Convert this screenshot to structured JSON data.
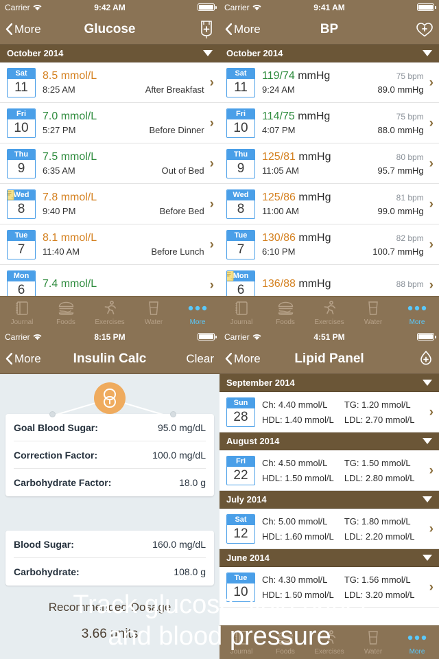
{
  "caption": {
    "line1": "Track glucose, lipid panel",
    "line2": "and blood pressure"
  },
  "colors": {
    "nav_bar": "#8a7355",
    "month_header": "#6b5637",
    "badge_blue": "#4a9fe8",
    "value_normal": "#2e8b3d",
    "value_high": "#d4801f",
    "tab_active": "#5ac8fa",
    "pill_circle": "#efab5e"
  },
  "tabbar": {
    "items": [
      {
        "label": "Journal",
        "icon": "journal-icon",
        "active": false
      },
      {
        "label": "Foods",
        "icon": "burger-icon",
        "active": false
      },
      {
        "label": "Exercises",
        "icon": "runner-icon",
        "active": false
      },
      {
        "label": "Water",
        "icon": "glass-icon",
        "active": false
      },
      {
        "label": "More",
        "icon": "ellipsis-icon",
        "active": true
      }
    ]
  },
  "glucose": {
    "status": {
      "carrier": "Carrier",
      "time": "9:42 AM",
      "wifi": "wifi-icon",
      "battery": "battery-icon"
    },
    "nav": {
      "back": "More",
      "title": "Glucose",
      "action_icon": "iv-bag-plus-icon"
    },
    "month": "October 2014",
    "rows": [
      {
        "dow": "Sat",
        "day": "11",
        "value": "8.5",
        "unit": "mmol/L",
        "level": "high",
        "time": "8:25 AM",
        "tag": "After Breakfast",
        "note": false
      },
      {
        "dow": "Fri",
        "day": "10",
        "value": "7.0",
        "unit": "mmol/L",
        "level": "normal",
        "time": "5:27 PM",
        "tag": "Before Dinner",
        "note": false
      },
      {
        "dow": "Thu",
        "day": "9",
        "value": "7.5",
        "unit": "mmol/L",
        "level": "normal",
        "time": "6:35 AM",
        "tag": "Out of Bed",
        "note": false
      },
      {
        "dow": "Wed",
        "day": "8",
        "value": "7.8",
        "unit": "mmol/L",
        "level": "high",
        "time": "9:40 PM",
        "tag": "Before Bed",
        "note": true
      },
      {
        "dow": "Tue",
        "day": "7",
        "value": "8.1",
        "unit": "mmol/L",
        "level": "high",
        "time": "11:40 AM",
        "tag": "Before Lunch",
        "note": false
      },
      {
        "dow": "Mon",
        "day": "6",
        "value": "7.4",
        "unit": "mmol/L",
        "level": "normal",
        "time": "",
        "tag": "",
        "note": false
      }
    ]
  },
  "bp": {
    "status": {
      "carrier": "Carrier",
      "time": "9:41 AM",
      "wifi": "wifi-icon",
      "battery": "battery-icon"
    },
    "nav": {
      "back": "More",
      "title": "BP",
      "action_icon": "heart-plus-icon"
    },
    "month": "October 2014",
    "rows": [
      {
        "dow": "Sat",
        "day": "11",
        "value": "119/74",
        "unit": "mmHg",
        "level": "normal",
        "time": "9:24 AM",
        "bpm": "75 bpm",
        "map": "89.0 mmHg",
        "note": false
      },
      {
        "dow": "Fri",
        "day": "10",
        "value": "114/75",
        "unit": "mmHg",
        "level": "normal",
        "time": "4:07 PM",
        "bpm": "75 bpm",
        "map": "88.0 mmHg",
        "note": false
      },
      {
        "dow": "Thu",
        "day": "9",
        "value": "125/81",
        "unit": "mmHg",
        "level": "high",
        "time": "11:05 AM",
        "bpm": "80 bpm",
        "map": "95.7 mmHg",
        "note": false
      },
      {
        "dow": "Wed",
        "day": "8",
        "value": "125/86",
        "unit": "mmHg",
        "level": "high",
        "time": "11:00 AM",
        "bpm": "81 bpm",
        "map": "99.0 mmHg",
        "note": false
      },
      {
        "dow": "Tue",
        "day": "7",
        "value": "130/86",
        "unit": "mmHg",
        "level": "high",
        "time": "6:10 PM",
        "bpm": "82 bpm",
        "map": "100.7 mmHg",
        "note": false
      },
      {
        "dow": "Mon",
        "day": "6",
        "value": "136/88",
        "unit": "mmHg",
        "level": "high",
        "time": "",
        "bpm": "88 bpm",
        "map": "",
        "note": true
      }
    ]
  },
  "insulin": {
    "status": {
      "carrier": "Carrier",
      "time": "8:15 PM",
      "wifi": "wifi-icon",
      "battery": "battery-icon"
    },
    "nav": {
      "back": "More",
      "title": "Insulin Calc",
      "action": "Clear"
    },
    "icon": "pill-icon",
    "card_one": [
      {
        "label": "Goal Blood Sugar:",
        "value": "95.0 mg/dL"
      },
      {
        "label": "Correction Factor:",
        "value": "100.0 mg/dL"
      },
      {
        "label": "Carbohydrate Factor:",
        "value": "18.0 g"
      }
    ],
    "card_two": [
      {
        "label": "Blood Sugar:",
        "value": "160.0 mg/dL"
      },
      {
        "label": "Carbohydrate:",
        "value": "108.0 g"
      }
    ],
    "dosage_label": "Recommended Dosage",
    "dosage_value": "3.66 units"
  },
  "lipid": {
    "status": {
      "carrier": "Carrier",
      "time": "4:51 PM",
      "wifi": "wifi-icon",
      "battery": "battery-icon"
    },
    "nav": {
      "back": "More",
      "title": "Lipid Panel",
      "action_icon": "blood-drop-plus-icon"
    },
    "sections": [
      {
        "month": "September 2014",
        "rows": [
          {
            "dow": "Sun",
            "day": "28",
            "ch": "Ch: 4.40 mmol/L",
            "tg": "TG: 1.20 mmol/L",
            "hdl": "HDL: 1.40 mmol/L",
            "ldl": "LDL: 2.70 mmol/L"
          }
        ]
      },
      {
        "month": "August 2014",
        "rows": [
          {
            "dow": "Fri",
            "day": "22",
            "ch": "Ch: 4.50 mmol/L",
            "tg": "TG: 1.50 mmol/L",
            "hdl": "HDL: 1.50 mmol/L",
            "ldl": "LDL: 2.80 mmol/L"
          }
        ]
      },
      {
        "month": "July 2014",
        "rows": [
          {
            "dow": "Sat",
            "day": "12",
            "ch": "Ch: 5.00 mmol/L",
            "tg": "TG: 1.80 mmol/L",
            "hdl": "HDL: 1.60 mmol/L",
            "ldl": "LDL: 2.20 mmol/L"
          }
        ]
      },
      {
        "month": "June 2014",
        "rows": [
          {
            "dow": "Tue",
            "day": "10",
            "ch": "Ch: 4.30 mmol/L",
            "tg": "TG: 1.56 mmol/L",
            "hdl": "HDL: 1.60 mmol/L",
            "ldl": "LDL: 3.20 mmol/L"
          }
        ]
      }
    ]
  }
}
